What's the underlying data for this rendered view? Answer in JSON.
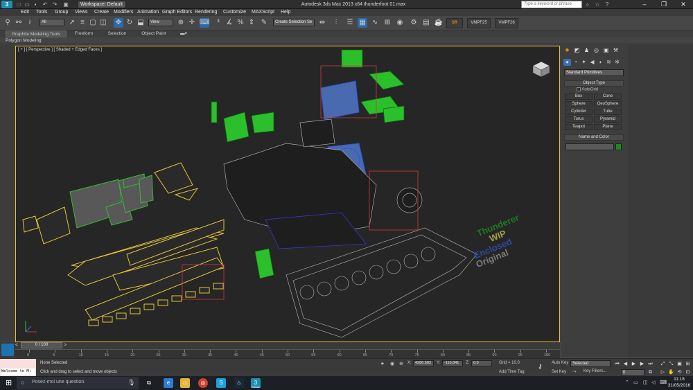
{
  "window": {
    "title": "Autodesk 3ds Max  2013 x64       thunderfoot 01.max",
    "workspace_label": "Workspace: Default",
    "help_search_placeholder": "Type a keyword or phrase"
  },
  "menu": [
    "Edit",
    "Tools",
    "Group",
    "Views",
    "Create",
    "Modifiers",
    "Animation",
    "Graph Editors",
    "Rendering",
    "Customize",
    "MAXScript",
    "Help"
  ],
  "toolbar": {
    "selection_filter": "All",
    "ref_coord": "View",
    "named_selection": "Create Selection Se",
    "plugin_sr": "SR",
    "vray_fb_1": "VMPF25",
    "vray_fb_2": "VMPF26"
  },
  "ribbon": {
    "tabs": [
      "Graphite Modeling Tools",
      "Freeform",
      "Selection",
      "Object Paint"
    ],
    "active_tab": "Graphite Modeling Tools",
    "sub_label": "Polygon Modeling"
  },
  "viewport": {
    "label": "[ + ] [ Perspective ] [ Shaded + Edged Faces ]",
    "text_objects": [
      "Thunderer",
      "WIP",
      "Enclosed",
      "Original"
    ]
  },
  "command_panel": {
    "category_dropdown": "Standard Primitives",
    "object_type_title": "Object Type",
    "autogrid_label": "AutoGrid",
    "primitives": [
      "Box",
      "Cone",
      "Sphere",
      "GeoSphere",
      "Cylinder",
      "Tube",
      "Torus",
      "Pyramid",
      "Teapot",
      "Plane"
    ],
    "name_color_title": "Name and Color",
    "object_color": "#1a8c1a"
  },
  "timeline": {
    "slider_label": "0 / 100",
    "ticks": [
      "0",
      "5",
      "10",
      "15",
      "20",
      "25",
      "30",
      "35",
      "40",
      "45",
      "50",
      "55",
      "60",
      "65",
      "70",
      "75",
      "80",
      "85",
      "90",
      "95",
      "100"
    ]
  },
  "status": {
    "listener_text": "Welcome to M:",
    "selection_info": "None Selected",
    "prompt": "Click and drag to select and move objects",
    "x_label": "X:",
    "x_value": "4286.583",
    "y_label": "Y:",
    "y_value": "-110.841",
    "z_label": "Z:",
    "z_value": "0.0",
    "grid": "Grid = 10.0",
    "add_time_tag": "Add Time Tag",
    "auto_key": "Auto Key",
    "set_key": "Set Key",
    "selected_dropdown": "Selected",
    "key_filters": "Key Filters...",
    "frame": "0"
  },
  "taskbar": {
    "search_placeholder": "Posez-moi une question.",
    "time": "11:18",
    "date": "31/05/2016"
  }
}
